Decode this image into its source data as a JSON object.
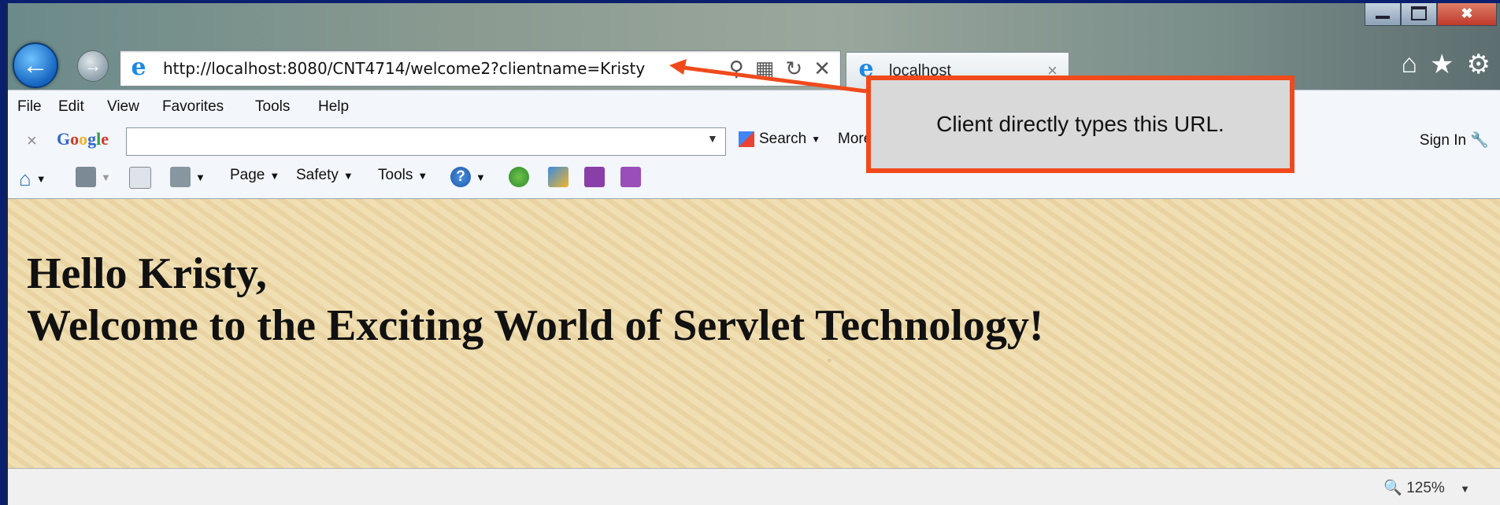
{
  "browser": {
    "url": "http://localhost:8080/CNT4714/welcome2?clientname=Kristy",
    "tab_title": "localhost",
    "menu": [
      "File",
      "Edit",
      "View",
      "Favorites",
      "Tools",
      "Help"
    ],
    "google_toolbar": {
      "logo": "Google",
      "search_label": "Search",
      "more_label": "More",
      "sign_in_label": "Sign In"
    },
    "command_bar": {
      "page_label": "Page",
      "safety_label": "Safety",
      "tools_label": "Tools"
    },
    "status": {
      "zoom": "125%"
    }
  },
  "page": {
    "greeting_line1": "Hello Kristy,",
    "greeting_line2": "Welcome to the Exciting World of Servlet Technology!"
  },
  "annotation": {
    "text": "Client directly types this URL.",
    "color": "#f04a1c"
  }
}
